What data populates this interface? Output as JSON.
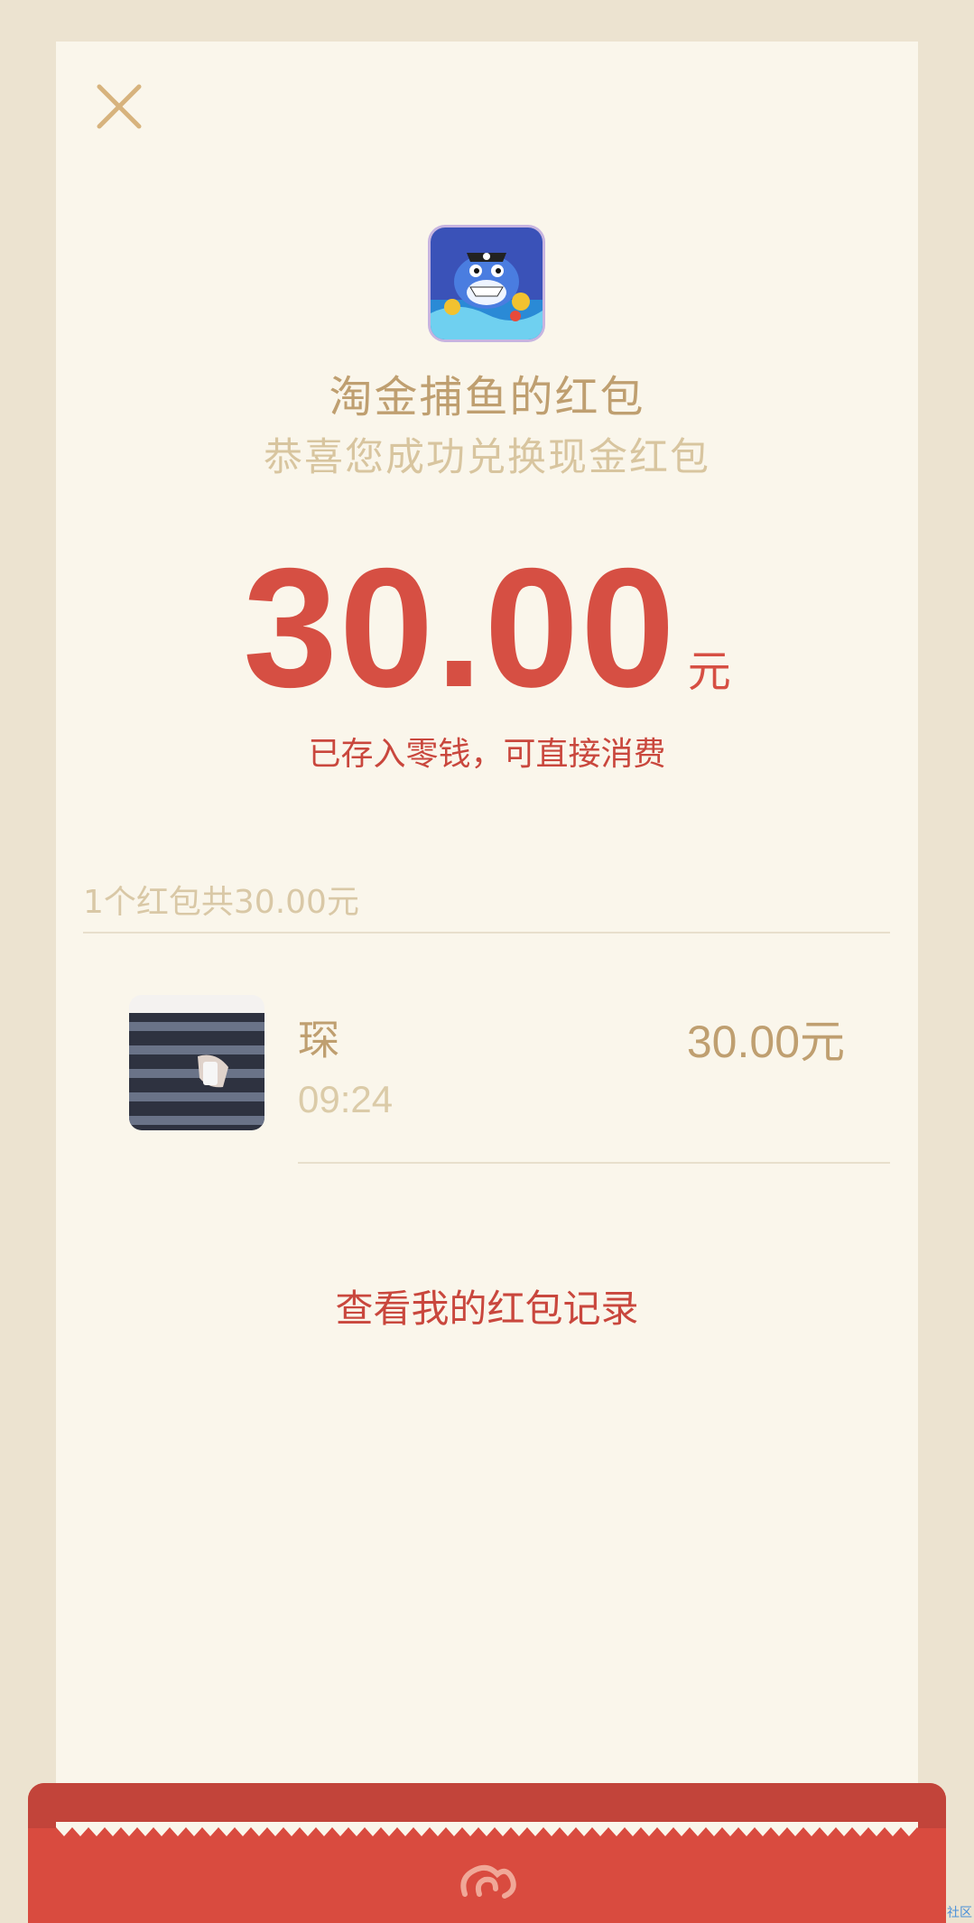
{
  "redpacket": {
    "sender": "淘金捕鱼的红包",
    "subtitle": "恭喜您成功兑换现金红包",
    "amount": "30.00",
    "unit": "元",
    "note": "已存入零钱，可直接消费"
  },
  "summary": {
    "text": "1个红包共30.00元"
  },
  "receiver": {
    "name": "琛",
    "time": "09:24",
    "amount": "30.00元"
  },
  "link": {
    "label": "查看我的红包记录"
  },
  "watermark": "社区",
  "colors": {
    "accent_red": "#d64f43",
    "gold_text": "#bf9f70",
    "card_bg": "#faf6eb",
    "page_bg": "#ece3d0"
  },
  "icons": {
    "close": "close-icon",
    "app": "shark-game-app-icon",
    "avatar": "user-avatar",
    "band_logo": "cloud-swirl-icon"
  }
}
